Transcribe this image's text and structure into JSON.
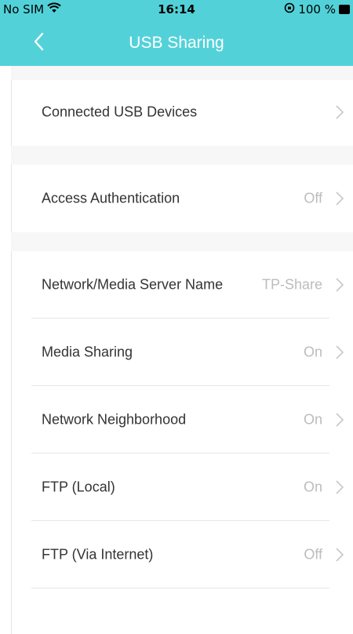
{
  "status_bar": {
    "carrier": "No SIM",
    "time": "16:14",
    "battery": "100 %"
  },
  "nav": {
    "title": "USB Sharing"
  },
  "sections": [
    {
      "items": [
        {
          "label": "Connected USB Devices",
          "value": ""
        }
      ]
    },
    {
      "items": [
        {
          "label": "Access Authentication",
          "value": "Off"
        }
      ]
    },
    {
      "items": [
        {
          "label": "Network/Media Server Name",
          "value": "TP-Share"
        },
        {
          "label": "Media Sharing",
          "value": "On"
        },
        {
          "label": "Network Neighborhood",
          "value": "On"
        },
        {
          "label": "FTP (Local)",
          "value": "On"
        },
        {
          "label": "FTP (Via Internet)",
          "value": "Off"
        }
      ]
    }
  ],
  "colors": {
    "header": "#52d2d8",
    "label": "#333333",
    "value": "#bcbcbc"
  }
}
